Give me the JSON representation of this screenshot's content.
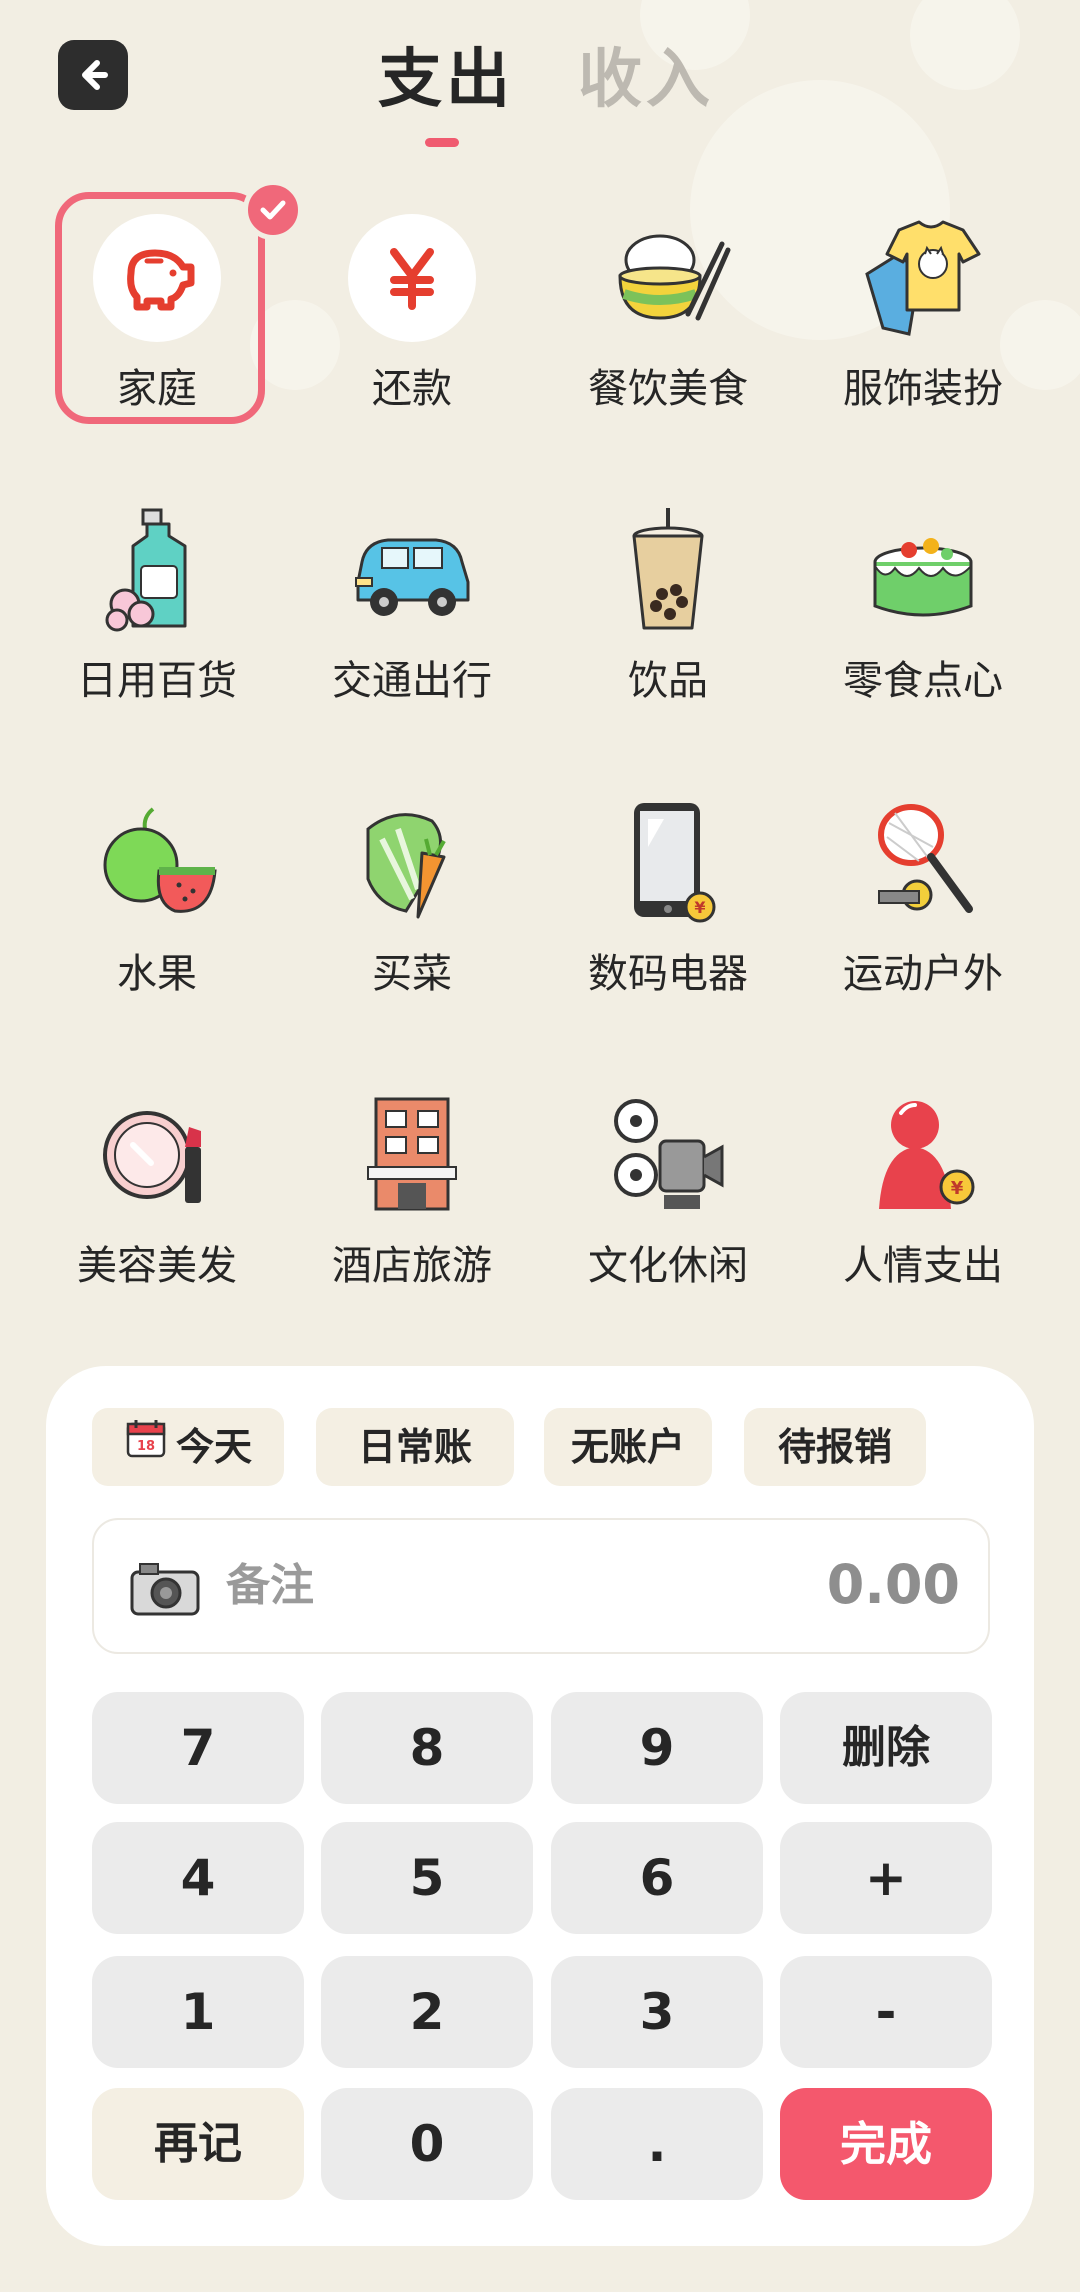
{
  "header": {
    "tabs": [
      {
        "label": "支出",
        "active": true
      },
      {
        "label": "收入",
        "active": false
      }
    ]
  },
  "categories": [
    {
      "label": "家庭",
      "icon": "piggy-bank-icon",
      "selected": true
    },
    {
      "label": "还款",
      "icon": "yuan-icon"
    },
    {
      "label": "餐饮美食",
      "icon": "rice-bowl-icon"
    },
    {
      "label": "服饰装扮",
      "icon": "tshirt-icon"
    },
    {
      "label": "日用百货",
      "icon": "lotion-bottle-icon"
    },
    {
      "label": "交通出行",
      "icon": "car-icon"
    },
    {
      "label": "饮品",
      "icon": "bubble-tea-icon"
    },
    {
      "label": "零食点心",
      "icon": "cake-icon"
    },
    {
      "label": "水果",
      "icon": "fruit-icon"
    },
    {
      "label": "买菜",
      "icon": "vegetables-icon"
    },
    {
      "label": "数码电器",
      "icon": "phone-icon"
    },
    {
      "label": "运动户外",
      "icon": "tennis-racket-icon"
    },
    {
      "label": "美容美发",
      "icon": "makeup-icon"
    },
    {
      "label": "酒店旅游",
      "icon": "hotel-icon"
    },
    {
      "label": "文化休闲",
      "icon": "film-projector-icon"
    },
    {
      "label": "人情支出",
      "icon": "gift-person-icon"
    }
  ],
  "entry": {
    "chips": [
      {
        "label": "今天",
        "icon": "calendar-icon"
      },
      {
        "label": "日常账"
      },
      {
        "label": "无账户"
      },
      {
        "label": "待报销"
      }
    ],
    "note_placeholder": "备注",
    "amount": "0.00"
  },
  "keypad": {
    "rows": [
      [
        "7",
        "8",
        "9",
        "删除"
      ],
      [
        "4",
        "5",
        "6",
        "+"
      ],
      [
        "1",
        "2",
        "3",
        "-"
      ],
      [
        "再记",
        "0",
        ".",
        "完成"
      ]
    ]
  },
  "colors": {
    "accent": "#f4586d",
    "background": "#f2eee3",
    "panel": "#ffffff"
  }
}
